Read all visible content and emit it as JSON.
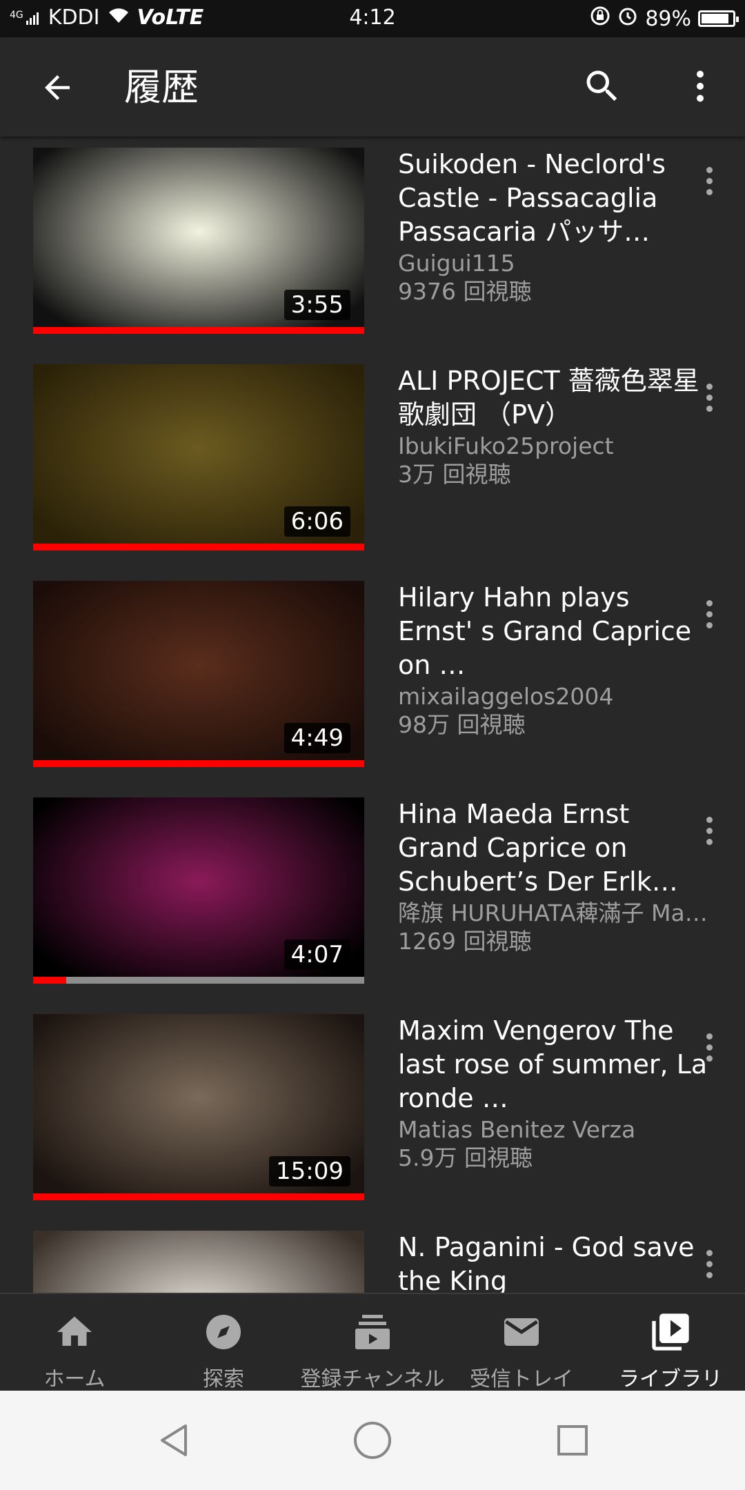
{
  "status_bar": {
    "signal": "4G",
    "carrier": "KDDI",
    "volte": "VoLTE",
    "time": "4:12",
    "battery": "89%",
    "battery_fraction": 0.89
  },
  "app_bar": {
    "title": "履歴"
  },
  "videos": [
    {
      "title": "Suikoden - Neclord's Castle - Passacaglia Passacaria パッサ…",
      "channel": "Guigui115",
      "views": "9376 回視聴",
      "duration": "3:55",
      "progress": 1.0,
      "thumb_colors": [
        "#f3f3e0",
        "#111111"
      ]
    },
    {
      "title": "ALI PROJECT 薔薇色翠星歌劇団 （PV）",
      "channel": "IbukiFuko25project",
      "views": "3万 回視聴",
      "duration": "6:06",
      "progress": 1.0,
      "thumb_colors": [
        "#6b5a20",
        "#2a2108"
      ]
    },
    {
      "title": "Hilary Hahn plays Ernst' s Grand Caprice on …",
      "channel": "mixailaggelos2004",
      "views": "98万 回視聴",
      "duration": "4:49",
      "progress": 1.0,
      "thumb_colors": [
        "#5a2d1c",
        "#1a0c08"
      ]
    },
    {
      "title": "Hina Maeda Ernst Grand Caprice on Schubert’s Der Erlk…",
      "channel": "降旗 HURUHATA薭滿子 Ma…",
      "views": "1269 回視聴",
      "duration": "4:07",
      "progress": 0.1,
      "thumb_colors": [
        "#8b1a5a",
        "#000000"
      ]
    },
    {
      "title": "Maxim Vengerov The last rose of summer, La ronde …",
      "channel": "Matias Benitez Verza",
      "views": "5.9万 回視聴",
      "duration": "15:09",
      "progress": 1.0,
      "thumb_colors": [
        "#7a6a5a",
        "#1c1410"
      ]
    },
    {
      "title": "N. Paganini - God save the King",
      "channel": "",
      "views": "",
      "duration": "",
      "progress": 0,
      "thumb_colors": [
        "#e8e4dc",
        "#3a302a"
      ]
    }
  ],
  "bottom_nav": [
    {
      "label": "ホーム",
      "icon": "home-icon",
      "active": false
    },
    {
      "label": "探索",
      "icon": "explore-icon",
      "active": false
    },
    {
      "label": "登録チャンネル",
      "icon": "subscriptions-icon",
      "active": false
    },
    {
      "label": "受信トレイ",
      "icon": "inbox-icon",
      "active": false
    },
    {
      "label": "ライブラリ",
      "icon": "library-icon",
      "active": true
    }
  ],
  "system_nav": [
    "back-triangle-icon",
    "home-circle-icon",
    "recents-square-icon"
  ]
}
